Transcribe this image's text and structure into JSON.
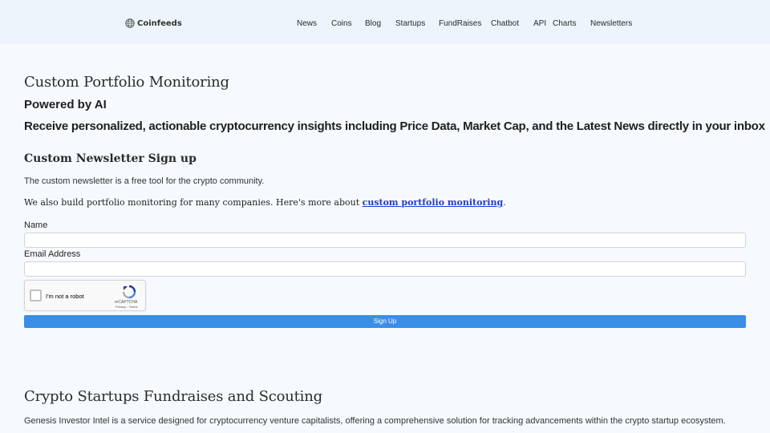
{
  "nav": {
    "brand": "Coinfeeds",
    "links": [
      "News",
      "Coins",
      "Blog",
      "Startups",
      "FundRaises",
      "Chatbot",
      "API",
      "Charts",
      "Newsletters"
    ]
  },
  "hero": {
    "title": "Custom Portfolio Monitoring",
    "subtitle": "Powered by AI",
    "tagline": "Receive personalized, actionable cryptocurrency insights including Price Data, Market Cap, and the Latest News directly in your inbox"
  },
  "signup": {
    "heading": "Custom Newsletter Sign up",
    "intro": "The custom newsletter is a free tool for the crypto community.",
    "portfolio_text": "We also build portfolio monitoring for many companies. Here's more about ",
    "portfolio_link": "custom portfolio monitoring",
    "portfolio_end": ".",
    "name_label": "Name",
    "name_value": "",
    "email_label": "Email Address",
    "email_value": "",
    "captcha_label": "I'm not a robot",
    "captcha_brand": "reCAPTCHA",
    "captcha_terms": "Privacy - Terms",
    "button_label": "Sign Up"
  },
  "startups": {
    "heading": "Crypto Startups Fundraises and Scouting",
    "description": "Genesis Investor Intel is a service designed for cryptocurrency venture capitalists, offering a comprehensive solution for tracking advancements within the crypto startup ecosystem."
  },
  "colors": {
    "navbar_bg": "#edf4fc",
    "page_bg": "#f6fafe",
    "button_bg": "#3a8ee6",
    "link": "#1a3fd1"
  }
}
